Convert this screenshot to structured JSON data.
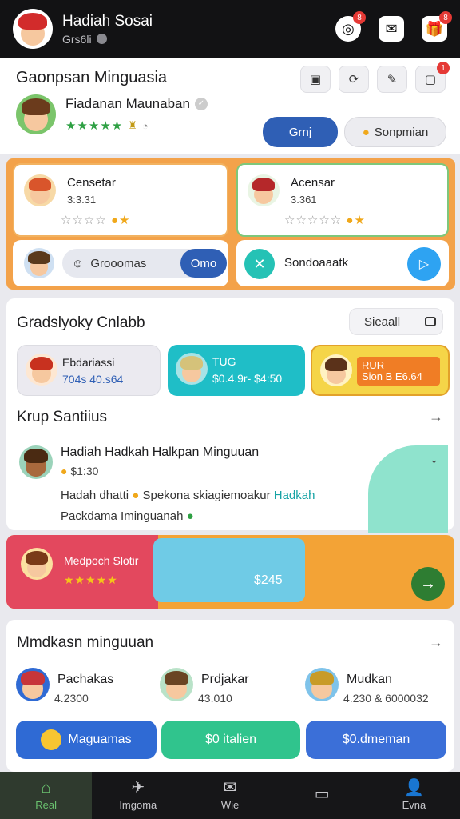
{
  "topbar": {
    "title": "Hadiah Sosai",
    "subtitle": "Grs6li",
    "badges": [
      "8",
      "8"
    ]
  },
  "profile": {
    "section_title": "Gaonpsan Minguasia",
    "name": "Fiadanan Maunaban",
    "stars": "★★★★★",
    "primary_button": "Grnj",
    "secondary_button": "Sonpmian",
    "notif_badge": "1"
  },
  "friends": [
    {
      "name": "Censetar",
      "meta": "3:3.31",
      "stars": "☆☆☆☆"
    },
    {
      "name": "Acensar",
      "meta": "3.361",
      "stars": "☆☆☆☆☆"
    }
  ],
  "groups": {
    "pill_label": "Grooomas",
    "pill_button": "Omo",
    "link_label": "Sondoaaatk"
  },
  "main": {
    "title": "Gradslyoky Cnlabb",
    "see_all": "Sieaall",
    "highlights": [
      {
        "title": "Ebdariassi",
        "value": "704s 40.s64"
      },
      {
        "title": "TUG",
        "value": "$0.4.9r- $4:50"
      },
      {
        "title": "RUR",
        "value": "Sion B E6.64"
      }
    ],
    "list_title": "Krup Santiius",
    "item": {
      "title": "Hadiah Hadkah Halkpan Minguuan",
      "meta": "$1:30",
      "desc_1": "Hadah dhatti",
      "desc_2": "Spekona skiagiemoakur",
      "desc_3": "Hadkah",
      "desc_4": "Packdama Iminguanah"
    }
  },
  "promo": {
    "title": "Medpoch Slotir",
    "stars": "★★★★★",
    "price": "$245"
  },
  "bottom": {
    "title": "Mmdkasn minguuan",
    "people": [
      {
        "name": "Pachakas",
        "meta": "4.2300"
      },
      {
        "name": "Prdjakar",
        "meta": "43.010"
      },
      {
        "name": "Mudkan",
        "meta": "4.230 & 6000032"
      }
    ],
    "buttons": [
      "Maguamas",
      "$0 italien",
      "$0.dmeman"
    ]
  },
  "nav": [
    "Real",
    "Imgoma",
    "Wie",
    "",
    "Evna"
  ],
  "colors": {
    "accent": "#2f5fb5",
    "orange": "#f3a24a",
    "teal": "#1fbec7",
    "green": "#30c48d"
  }
}
